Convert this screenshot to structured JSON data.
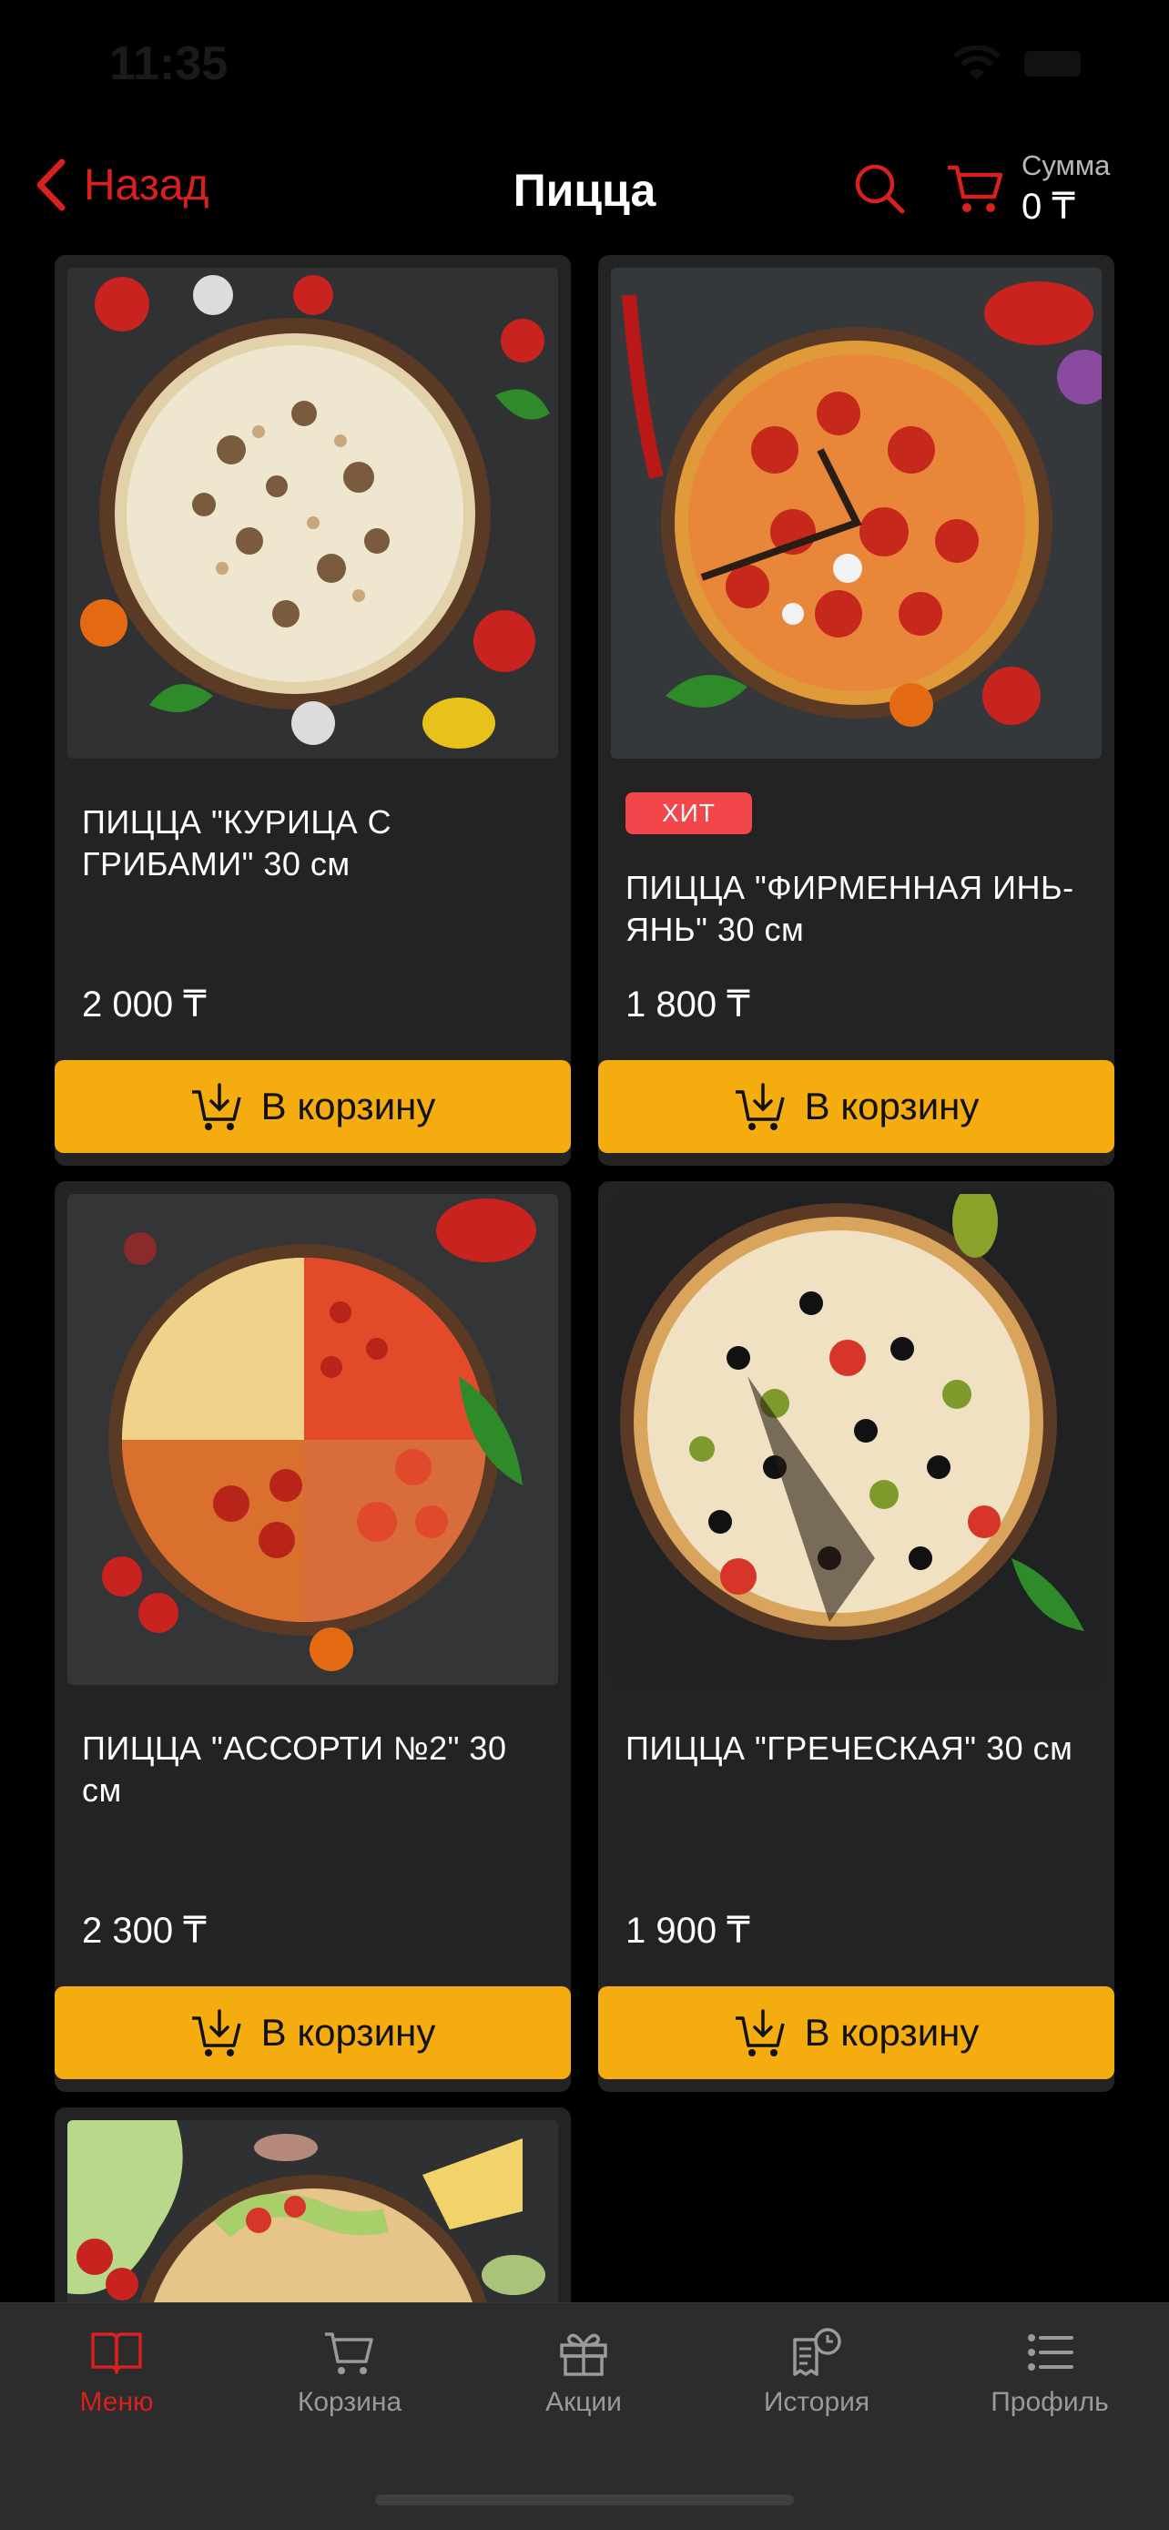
{
  "status": {
    "time": "11:35"
  },
  "header": {
    "back_label": "Назад",
    "title": "Пицца",
    "sum_label": "Сумма",
    "sum_value": "0 ₸"
  },
  "colors": {
    "accent": "#d8201f",
    "button": "#f4ac0e",
    "badge": "#f2464a",
    "card": "#232323"
  },
  "products": [
    {
      "name": "ПИЦЦА \"КУРИЦА С ГРИБАМИ\" 30 см",
      "price": "2 000 ₸",
      "badge": "",
      "button": "В корзину",
      "image": "pizza-chicken-mushroom"
    },
    {
      "name": "ПИЦЦА \"ФИРМЕННАЯ ИНЬ-ЯНЬ\" 30 см",
      "price": "1 800 ₸",
      "badge": "ХИТ",
      "button": "В корзину",
      "image": "pizza-pepperoni"
    },
    {
      "name": "ПИЦЦА \"АССОРТИ №2\" 30 см",
      "price": "2 300 ₸",
      "badge": "",
      "button": "В корзину",
      "image": "pizza-assorti"
    },
    {
      "name": "ПИЦЦА \"ГРЕЧЕСКАЯ\" 30 см",
      "price": "1 900 ₸",
      "badge": "",
      "button": "В корзину",
      "image": "pizza-greek"
    }
  ],
  "tabs": [
    {
      "label": "Меню",
      "icon": "book-icon",
      "active": true
    },
    {
      "label": "Корзина",
      "icon": "cart-icon",
      "active": false
    },
    {
      "label": "Акции",
      "icon": "gift-icon",
      "active": false
    },
    {
      "label": "История",
      "icon": "history-icon",
      "active": false
    },
    {
      "label": "Профиль",
      "icon": "list-icon",
      "active": false
    }
  ]
}
